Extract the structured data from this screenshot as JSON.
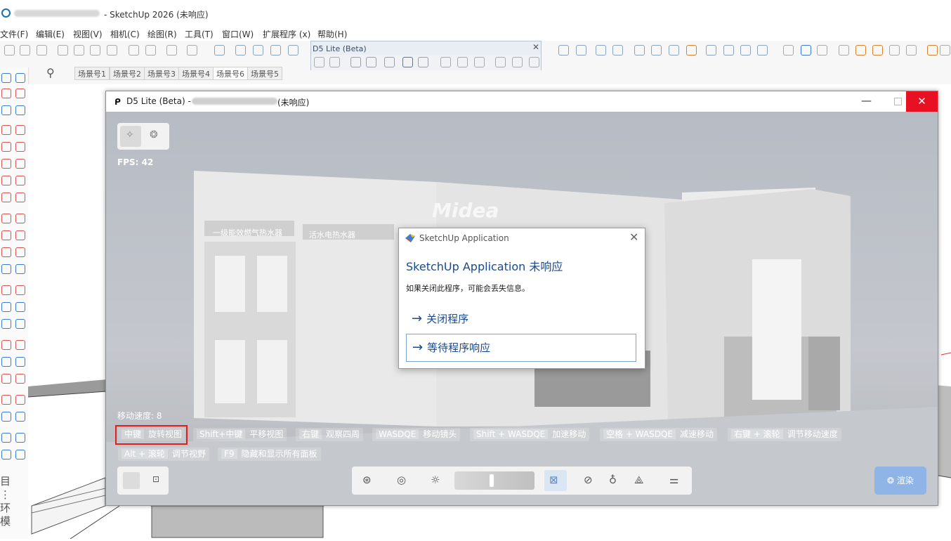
{
  "sketchup": {
    "title": "- SketchUp 2026 (未响应)",
    "menu": [
      "文件(F)",
      "编辑(E)",
      "视图(V)",
      "相机(C)",
      "绘图(R)",
      "工具(T)",
      "窗口(W)",
      "扩展程序 (x)",
      "帮助(H)"
    ],
    "scene_tabs": [
      "场景号1",
      "场景号2",
      "场景号3",
      "场景号4",
      "场景号6",
      "场景号5"
    ],
    "active_scene": "场景号6",
    "left_vertical_text": [
      "目",
      "⋮",
      "环",
      "模"
    ]
  },
  "d5_float_toolbar": {
    "title": "D5 Lite (Beta)",
    "close": "✕"
  },
  "d5": {
    "title_prefix": "D5 Lite (Beta) - ",
    "title_suffix": "(未响应)",
    "logo_text": "Midea",
    "fps": "FPS: 42",
    "move_speed": "移动速度: 8",
    "hints": [
      {
        "key": "中键",
        "action": "旋转视图"
      },
      {
        "key": "Shift+中键",
        "action": "平移视图"
      },
      {
        "key": "右键",
        "action": "观察四周"
      },
      {
        "key": "WASDQE",
        "action": "移动镜头"
      },
      {
        "key": "Shift + WASDQE",
        "action": "加速移动"
      },
      {
        "key": "空格 + WASDQE",
        "action": "减速移动"
      },
      {
        "key": "右键 + 滚轮",
        "action": "调节移动速度"
      },
      {
        "key": "Alt + 滚轮",
        "action": "调节视野"
      },
      {
        "key": "F9",
        "action": "隐藏和显示所有面板"
      }
    ],
    "render_label": "渲染",
    "scene_signs": [
      "一级能效燃气热水器",
      "活水电热水器"
    ]
  },
  "dialog": {
    "title": "SketchUp Application",
    "heading": "SketchUp Application 未响应",
    "message": "如果关闭此程序，可能会丢失信息。",
    "option_close": "关闭程序",
    "option_wait": "等待程序响应",
    "close": "✕"
  },
  "colors": {
    "close_red": "#e81123",
    "highlight_red": "#e02020",
    "link_blue": "#1a4a8f",
    "render_blue": "#8fb4e6"
  }
}
